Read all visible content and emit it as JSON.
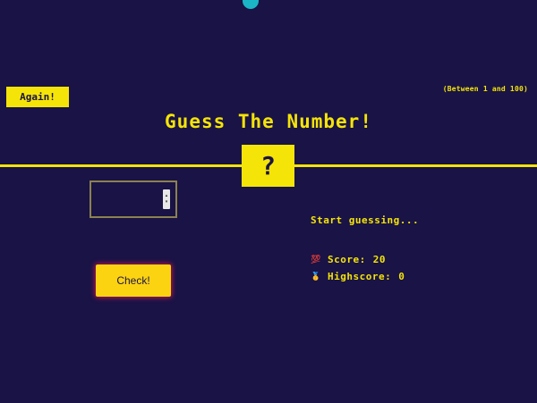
{
  "header": {
    "again_label": "Again!",
    "range_hint": "(Between 1 and 100)",
    "title": "Guess The Number!"
  },
  "secret": {
    "display": "?"
  },
  "guess_input": {
    "value": "",
    "spinner_up": "▴",
    "spinner_down": "▾"
  },
  "actions": {
    "check_label": "Check!"
  },
  "status": {
    "message": "Start guessing..."
  },
  "stats": {
    "score_icon": "💯",
    "score_label": "Score:",
    "score_value": "20",
    "highscore_icon": "🥇",
    "highscore_label": "Highscore:",
    "highscore_value": "0"
  },
  "colors": {
    "background": "#191346",
    "accent": "#f5e407",
    "check_button": "#fcd311",
    "top_dot": "#1ab6c6"
  }
}
